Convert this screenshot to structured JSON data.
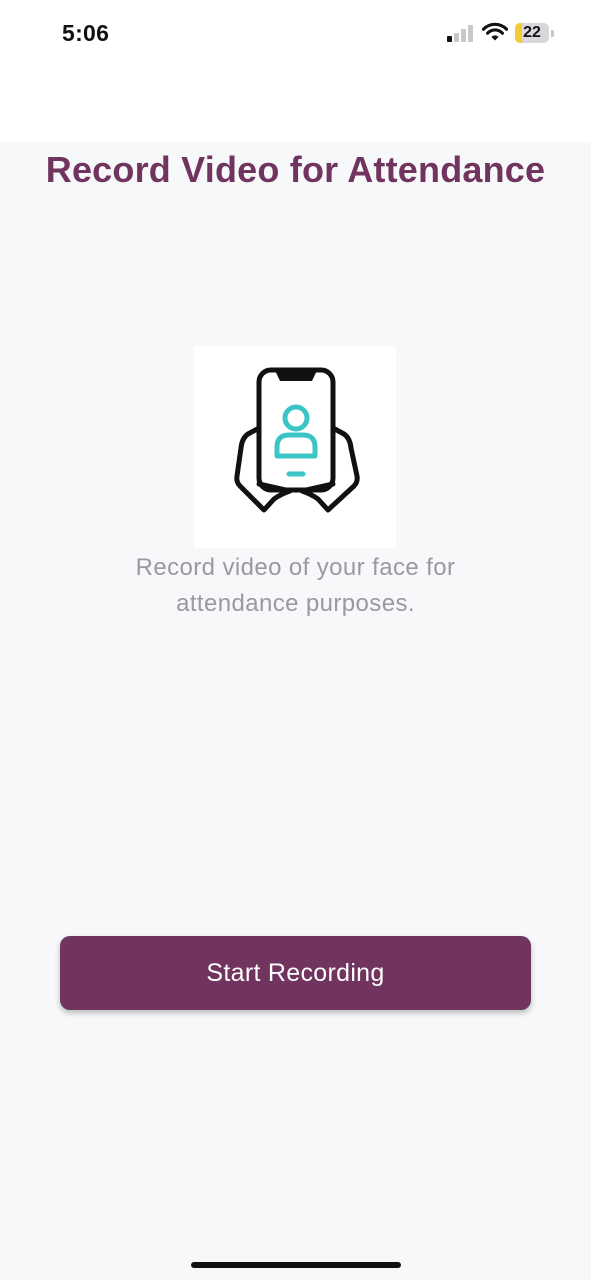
{
  "status_bar": {
    "time": "5:06",
    "battery_level": "22",
    "battery_fraction": 0.22,
    "icons": [
      "signal-icon",
      "wifi-icon",
      "battery-icon"
    ]
  },
  "main": {
    "title": "Record Video for Attendance",
    "illustration_icon": "phone-face-recording-icon",
    "description": "Record video of your face for attendance purposes.",
    "start_button_label": "Start Recording"
  },
  "colors": {
    "brand": "#70345f",
    "accent_teal": "#3cc5c6",
    "description_text": "#9a9a9e",
    "background": "#f7f8fa"
  }
}
